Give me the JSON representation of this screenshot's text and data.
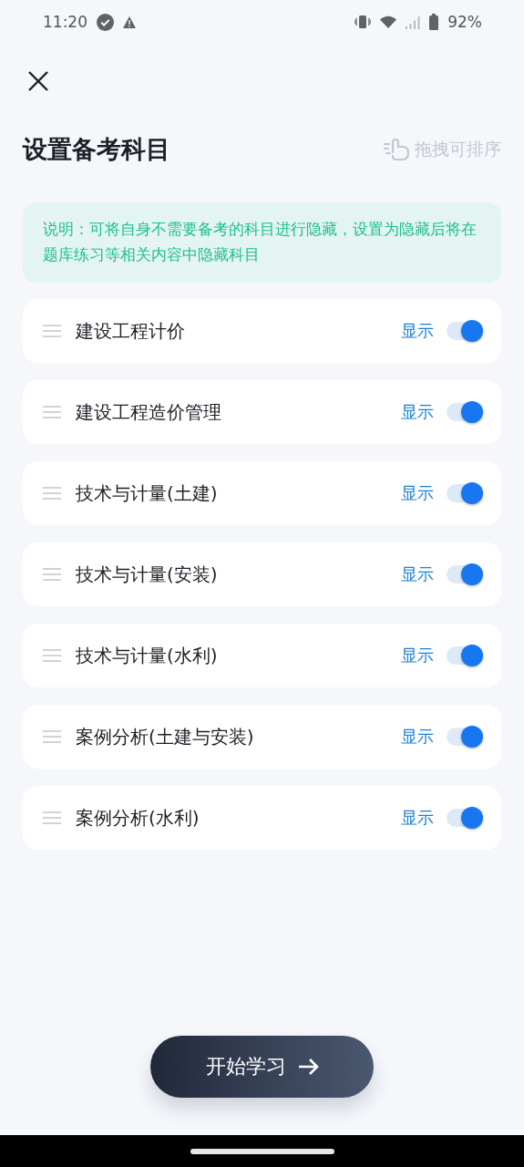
{
  "status_bar": {
    "time": "11:20",
    "battery": "92%"
  },
  "header": {
    "title": "设置备考科目",
    "hint": "拖拽可排序"
  },
  "notice": "说明：可将自身不需要备考的科目进行隐藏，设置为隐藏后将在题库练习等相关内容中隐藏科目",
  "subjects": [
    {
      "name": "建设工程计价",
      "state_label": "显示",
      "on": true
    },
    {
      "name": "建设工程造价管理",
      "state_label": "显示",
      "on": true
    },
    {
      "name": "技术与计量(土建)",
      "state_label": "显示",
      "on": true
    },
    {
      "name": "技术与计量(安装)",
      "state_label": "显示",
      "on": true
    },
    {
      "name": "技术与计量(水利)",
      "state_label": "显示",
      "on": true
    },
    {
      "name": "案例分析(土建与安装)",
      "state_label": "显示",
      "on": true
    },
    {
      "name": "案例分析(水利)",
      "state_label": "显示",
      "on": true
    }
  ],
  "start_button": {
    "label": "开始学习"
  }
}
